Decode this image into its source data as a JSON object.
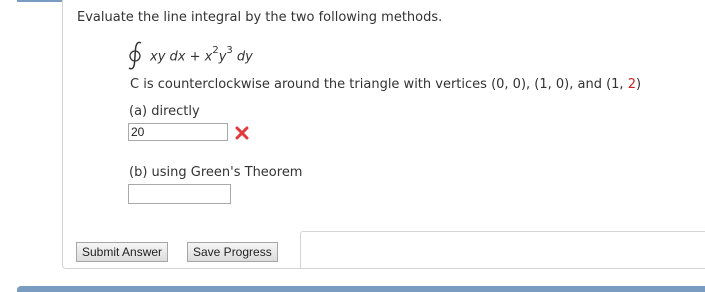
{
  "question": {
    "prompt": "Evaluate the line integral by the two following methods.",
    "integrand_part1": "xy dx + x",
    "exp1": "2",
    "integrand_part2": "y",
    "exp2": "3",
    "integrand_part3": " dy",
    "curve_text": "C is counterclockwise around the triangle with vertices (0, 0), (1, 0), and (1, ",
    "curve_last": "2",
    "curve_close": ")"
  },
  "parts": [
    {
      "label": "(a) directly",
      "value": "20",
      "status": "incorrect"
    },
    {
      "label": "(b) using Green's Theorem",
      "value": ""
    }
  ],
  "buttons": {
    "submit": "Submit Answer",
    "save": "Save Progress"
  },
  "colors": {
    "accent_bar": "#7a9cc0",
    "incorrect": "#e23a3a",
    "highlight_number": "#cc2222"
  },
  "icons": {
    "incorrect_mark": "x-mark-icon"
  }
}
